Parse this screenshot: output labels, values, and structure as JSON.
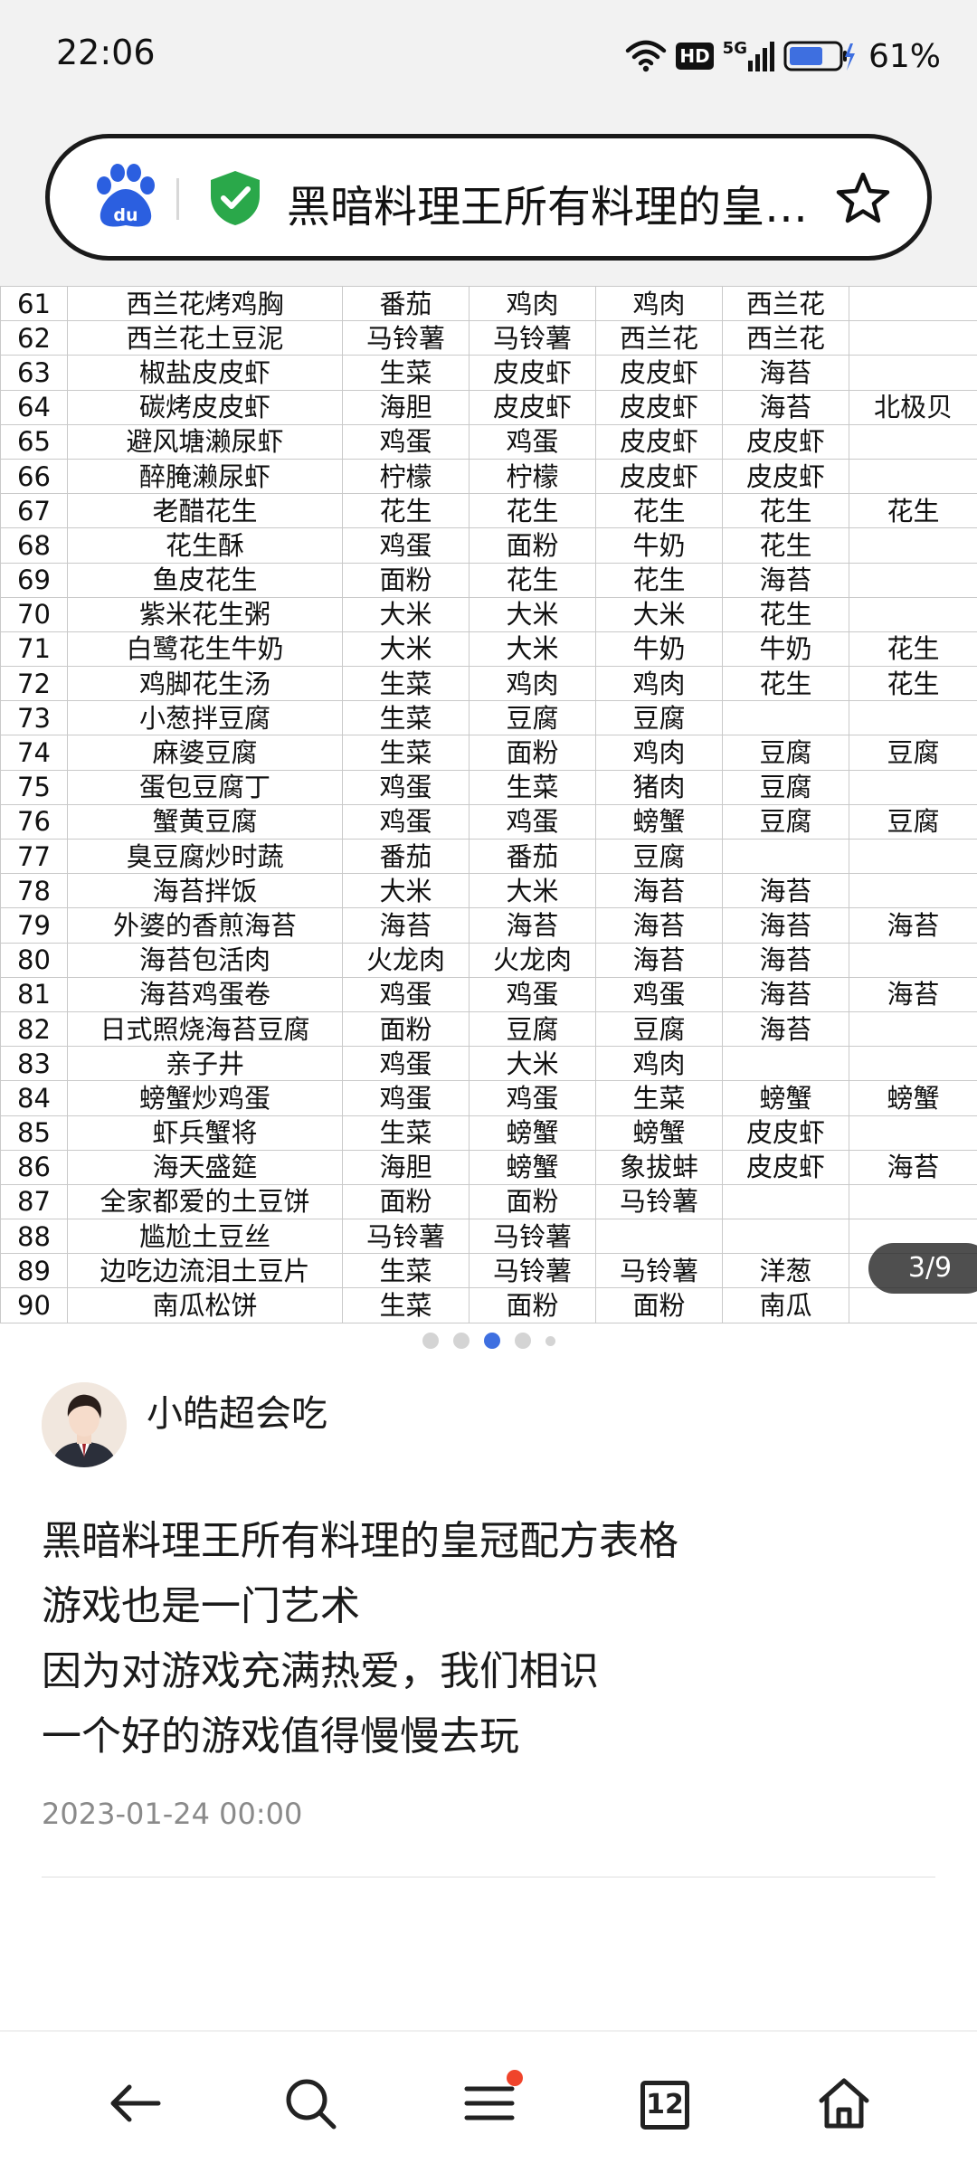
{
  "status_bar": {
    "time": "22:06",
    "network": "5G",
    "hd_label": "HD",
    "battery": "61%"
  },
  "address_bar": {
    "title": "黑暗料理王所有料理的皇冠配方表格"
  },
  "table": {
    "rows": [
      [
        "61",
        "西兰花烤鸡胸",
        "番茄",
        "鸡肉",
        "鸡肉",
        "西兰花",
        ""
      ],
      [
        "62",
        "西兰花土豆泥",
        "马铃薯",
        "马铃薯",
        "西兰花",
        "西兰花",
        ""
      ],
      [
        "63",
        "椒盐皮皮虾",
        "生菜",
        "皮皮虾",
        "皮皮虾",
        "海苔",
        ""
      ],
      [
        "64",
        "碳烤皮皮虾",
        "海胆",
        "皮皮虾",
        "皮皮虾",
        "海苔",
        "北极贝"
      ],
      [
        "65",
        "避风塘濑尿虾",
        "鸡蛋",
        "鸡蛋",
        "皮皮虾",
        "皮皮虾",
        ""
      ],
      [
        "66",
        "醉腌濑尿虾",
        "柠檬",
        "柠檬",
        "皮皮虾",
        "皮皮虾",
        ""
      ],
      [
        "67",
        "老醋花生",
        "花生",
        "花生",
        "花生",
        "花生",
        "花生"
      ],
      [
        "68",
        "花生酥",
        "鸡蛋",
        "面粉",
        "牛奶",
        "花生",
        ""
      ],
      [
        "69",
        "鱼皮花生",
        "面粉",
        "花生",
        "花生",
        "海苔",
        ""
      ],
      [
        "70",
        "紫米花生粥",
        "大米",
        "大米",
        "大米",
        "花生",
        ""
      ],
      [
        "71",
        "白鹭花生牛奶",
        "大米",
        "大米",
        "牛奶",
        "牛奶",
        "花生"
      ],
      [
        "72",
        "鸡脚花生汤",
        "生菜",
        "鸡肉",
        "鸡肉",
        "花生",
        "花生"
      ],
      [
        "73",
        "小葱拌豆腐",
        "生菜",
        "豆腐",
        "豆腐",
        "",
        ""
      ],
      [
        "74",
        "麻婆豆腐",
        "生菜",
        "面粉",
        "鸡肉",
        "豆腐",
        "豆腐"
      ],
      [
        "75",
        "蛋包豆腐丁",
        "鸡蛋",
        "生菜",
        "猪肉",
        "豆腐",
        ""
      ],
      [
        "76",
        "蟹黄豆腐",
        "鸡蛋",
        "鸡蛋",
        "螃蟹",
        "豆腐",
        "豆腐"
      ],
      [
        "77",
        "臭豆腐炒时蔬",
        "番茄",
        "番茄",
        "豆腐",
        "",
        ""
      ],
      [
        "78",
        "海苔拌饭",
        "大米",
        "大米",
        "海苔",
        "海苔",
        ""
      ],
      [
        "79",
        "外婆的香煎海苔",
        "海苔",
        "海苔",
        "海苔",
        "海苔",
        "海苔"
      ],
      [
        "80",
        "海苔包活肉",
        "火龙肉",
        "火龙肉",
        "海苔",
        "海苔",
        ""
      ],
      [
        "81",
        "海苔鸡蛋卷",
        "鸡蛋",
        "鸡蛋",
        "鸡蛋",
        "海苔",
        "海苔"
      ],
      [
        "82",
        "日式照烧海苔豆腐",
        "面粉",
        "豆腐",
        "豆腐",
        "海苔",
        ""
      ],
      [
        "83",
        "亲子井",
        "鸡蛋",
        "大米",
        "鸡肉",
        "",
        ""
      ],
      [
        "84",
        "螃蟹炒鸡蛋",
        "鸡蛋",
        "鸡蛋",
        "生菜",
        "螃蟹",
        "螃蟹"
      ],
      [
        "85",
        "虾兵蟹将",
        "生菜",
        "螃蟹",
        "螃蟹",
        "皮皮虾",
        ""
      ],
      [
        "86",
        "海天盛筵",
        "海胆",
        "螃蟹",
        "象拔蚌",
        "皮皮虾",
        "海苔"
      ],
      [
        "87",
        "全家都爱的土豆饼",
        "面粉",
        "面粉",
        "马铃薯",
        "",
        ""
      ],
      [
        "88",
        "尴尬土豆丝",
        "马铃薯",
        "马铃薯",
        "",
        "",
        ""
      ],
      [
        "89",
        "边吃边流泪土豆片",
        "生菜",
        "马铃薯",
        "马铃薯",
        "洋葱",
        ""
      ],
      [
        "90",
        "南瓜松饼",
        "生菜",
        "面粉",
        "面粉",
        "南瓜",
        ""
      ]
    ]
  },
  "image_counter": "3/9",
  "carousel": {
    "total_dots": 5,
    "active_index": 2
  },
  "author": {
    "name": "小皓超会吃"
  },
  "post": {
    "lines": [
      "黑暗料理王所有料理的皇冠配方表格",
      "游戏也是一门艺术",
      "因为对游戏充满热爱，我们相识",
      "一个好的游戏值得慢慢去玩"
    ],
    "date": "2023-01-24 00:00"
  },
  "bottom_nav": {
    "tab_count": "12"
  },
  "colors": {
    "accent": "#3e6fe0",
    "notification": "#f0442b",
    "shield": "#2aa84a",
    "baidu_blue": "#2b5fe0"
  }
}
